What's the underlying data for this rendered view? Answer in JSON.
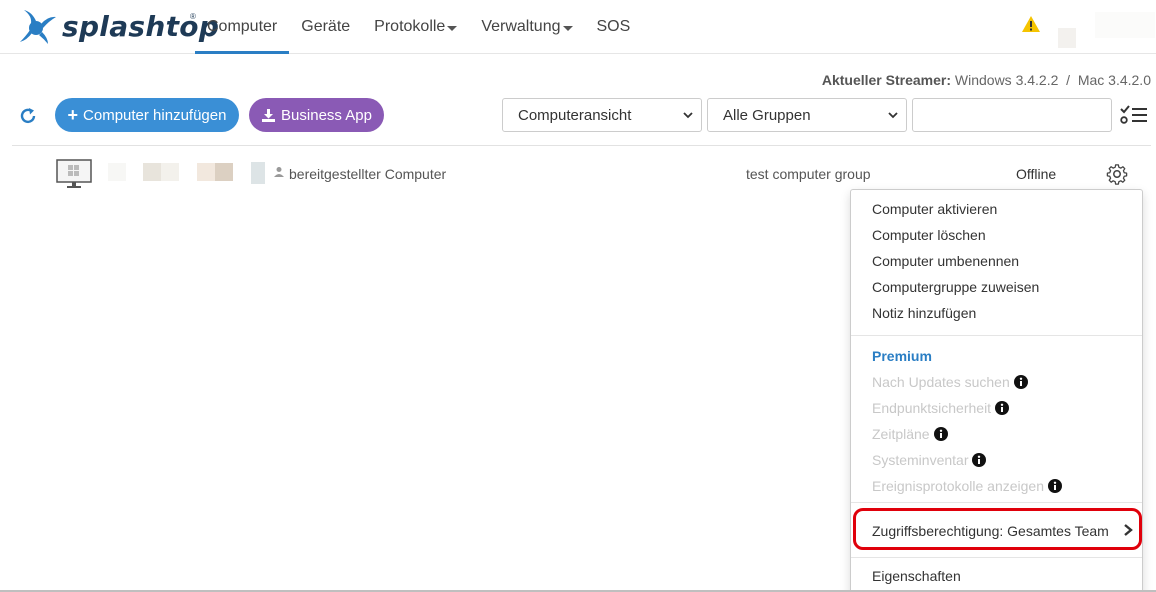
{
  "header": {
    "logo_text": "splashtop",
    "logo_mark": "®",
    "nav": [
      {
        "label": "Computer",
        "active": true
      },
      {
        "label": "Geräte"
      },
      {
        "label": "Protokolle",
        "dropdown": true
      },
      {
        "label": "Verwaltung",
        "dropdown": true
      },
      {
        "label": "SOS"
      }
    ],
    "warning_icon": "warning-triangle-icon"
  },
  "streamer": {
    "label": "Aktueller Streamer:",
    "value": "Windows 3.4.2.2  /  Mac 3.4.2.0"
  },
  "toolbar": {
    "add_label": "Computer hinzufügen",
    "business_label": "Business App",
    "view_select": "Computeransicht",
    "group_select": "Alle Gruppen",
    "search_value": ""
  },
  "row": {
    "name": "bereitgestellter Computer",
    "group": "test computer group",
    "status": "Offline"
  },
  "menu": {
    "items": [
      "Computer aktivieren",
      "Computer löschen",
      "Computer umbenennen",
      "Computergruppe zuweisen",
      "Notiz hinzufügen"
    ],
    "premium_label": "Premium",
    "premium_items": [
      "Nach Updates suchen",
      "Endpunktsicherheit",
      "Zeitpläne",
      "Systeminventar",
      "Ereignisprotokolle anzeigen"
    ],
    "access_label": "Zugriffsberechtigung: Gesamtes Team",
    "properties_label": "Eigenschaften"
  },
  "colors": {
    "accent": "#2a7ec4",
    "add_button": "#3a8fd6",
    "business_button": "#8a5ab5",
    "highlight": "#e0000b",
    "warning": "#f5c400"
  }
}
